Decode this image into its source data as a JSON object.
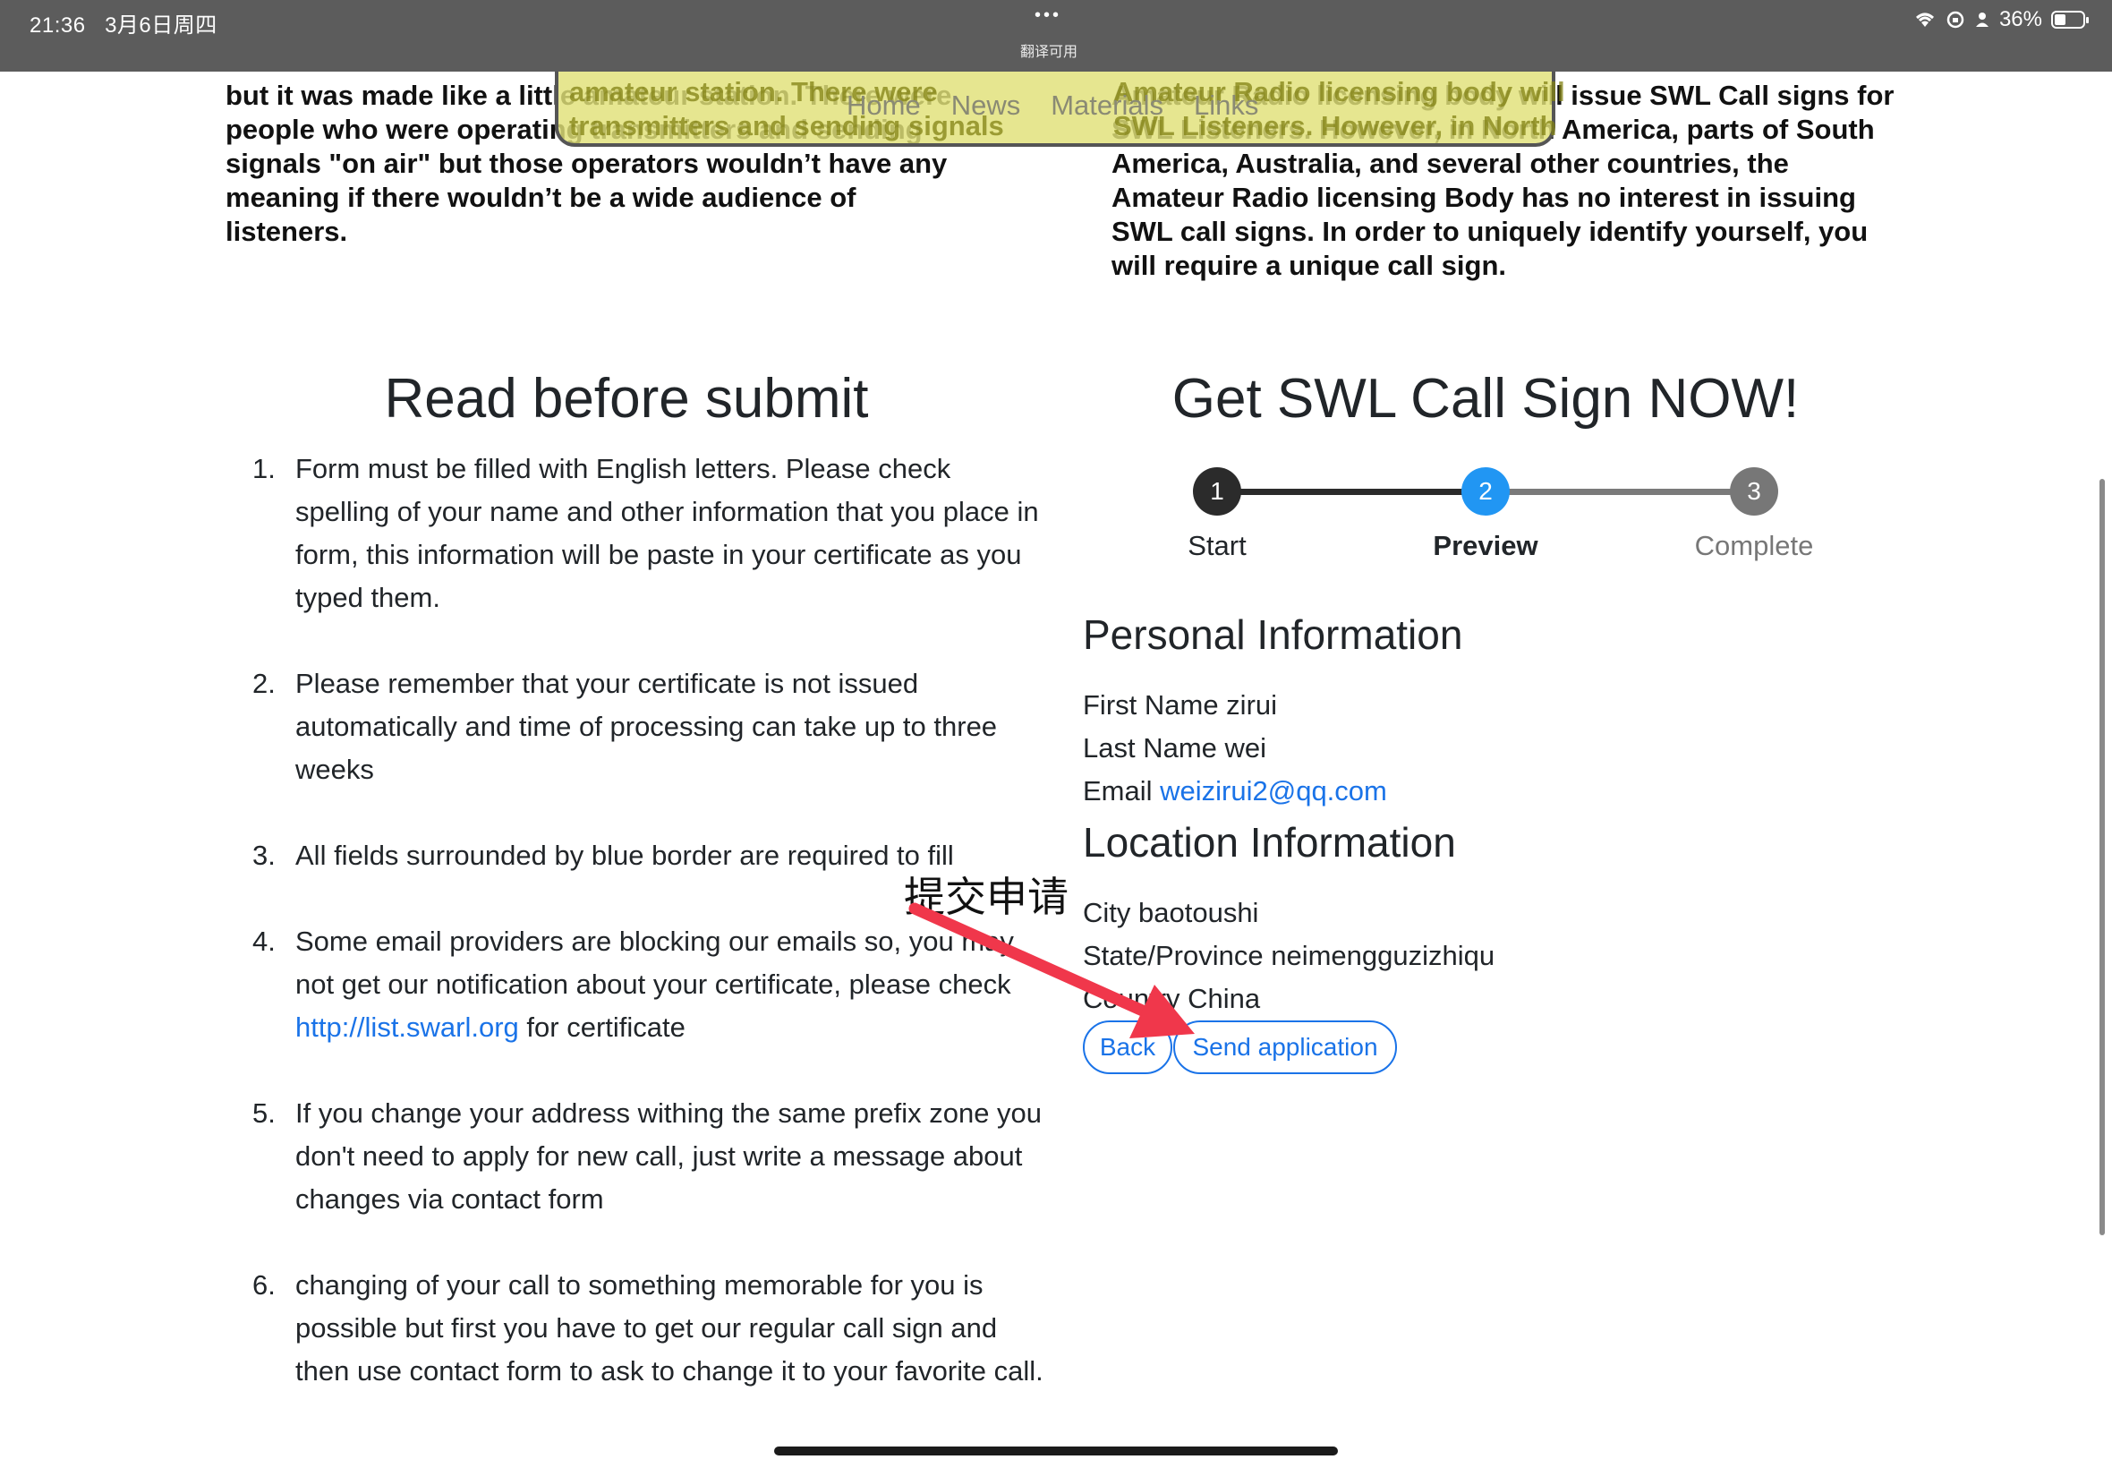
{
  "status_bar": {
    "time": "21:36",
    "date": "3月6日周四",
    "center_dots": "•••",
    "translate_hint": "翻译可用",
    "battery_percent": "36%",
    "battery_level": 0.36
  },
  "top_text": {
    "left_paragraph": "but it was made like a little amateur station. There were people who were operating transmitters and sending signals \"on air\" but those operators wouldn’t have any meaning if there wouldn’t be a wide audience of listeners.",
    "right_paragraph": "Amateur Radio licensing body will issue SWL Call signs for SWL Listeners. However, in North America, parts of South America, Australia, and several other countries, the Amateur Radio licensing Body has no interest in issuing SWL call signs. In order to uniquely identify yourself, you will require a unique call sign."
  },
  "nav": {
    "ghost_left": "amateur station. There were\ntransmitters and sending signals",
    "ghost_right": "Amateur Radio licensing body will\nSWL Listeners. However, in North",
    "items": [
      "Home",
      "News",
      "Materials",
      "Links"
    ]
  },
  "left": {
    "title": "Read before submit",
    "rules": [
      {
        "num": "1.",
        "text": "Form must be filled with English letters. Please check spelling of your name and other information that you place in form, this information will be paste in your certificate as you typed them."
      },
      {
        "num": "2.",
        "text": "Please remember that your certificate is not issued automatically and time of processing can take up to three weeks"
      },
      {
        "num": "3.",
        "text": "All fields surrounded by blue border are required to fill"
      },
      {
        "num": "4.",
        "text_before": "Some email providers are blocking our emails so, you may not get our notification about your certificate, please check ",
        "link": "http://list.swarl.org",
        "text_after": " for certificate"
      },
      {
        "num": "5.",
        "text": "If you change your address withing the same prefix zone you don't need to apply for new call, just write a message about changes via contact form"
      },
      {
        "num": "6.",
        "text": "changing of your call to something memorable for you is possible but first you have to get our regular call sign and then use contact form to ask to change it to your favorite call."
      }
    ]
  },
  "right": {
    "title": "Get SWL Call Sign NOW!",
    "steps": [
      {
        "number": "1",
        "label": "Start",
        "color": "#2b2b2b"
      },
      {
        "number": "2",
        "label": "Preview",
        "color": "#2196f3"
      },
      {
        "number": "3",
        "label": "Complete",
        "color": "#777777"
      }
    ],
    "personal": {
      "title": "Personal Information",
      "first_name": "First Name zirui",
      "last_name": "Last Name wei",
      "email_label": "Email ",
      "email": "weizirui2@qq.com"
    },
    "location": {
      "title": "Location Information",
      "city": "City baotoushi",
      "state": "State/Province neimengguzizhiqu",
      "country": "Country China"
    },
    "buttons": {
      "back": "Back",
      "send": "Send application"
    }
  },
  "annotation": {
    "text": "提交申请",
    "arrow_color": "#f0374b"
  },
  "colors": {
    "link": "#1a73e8",
    "step_active": "#2196f3",
    "text": "#212529"
  }
}
